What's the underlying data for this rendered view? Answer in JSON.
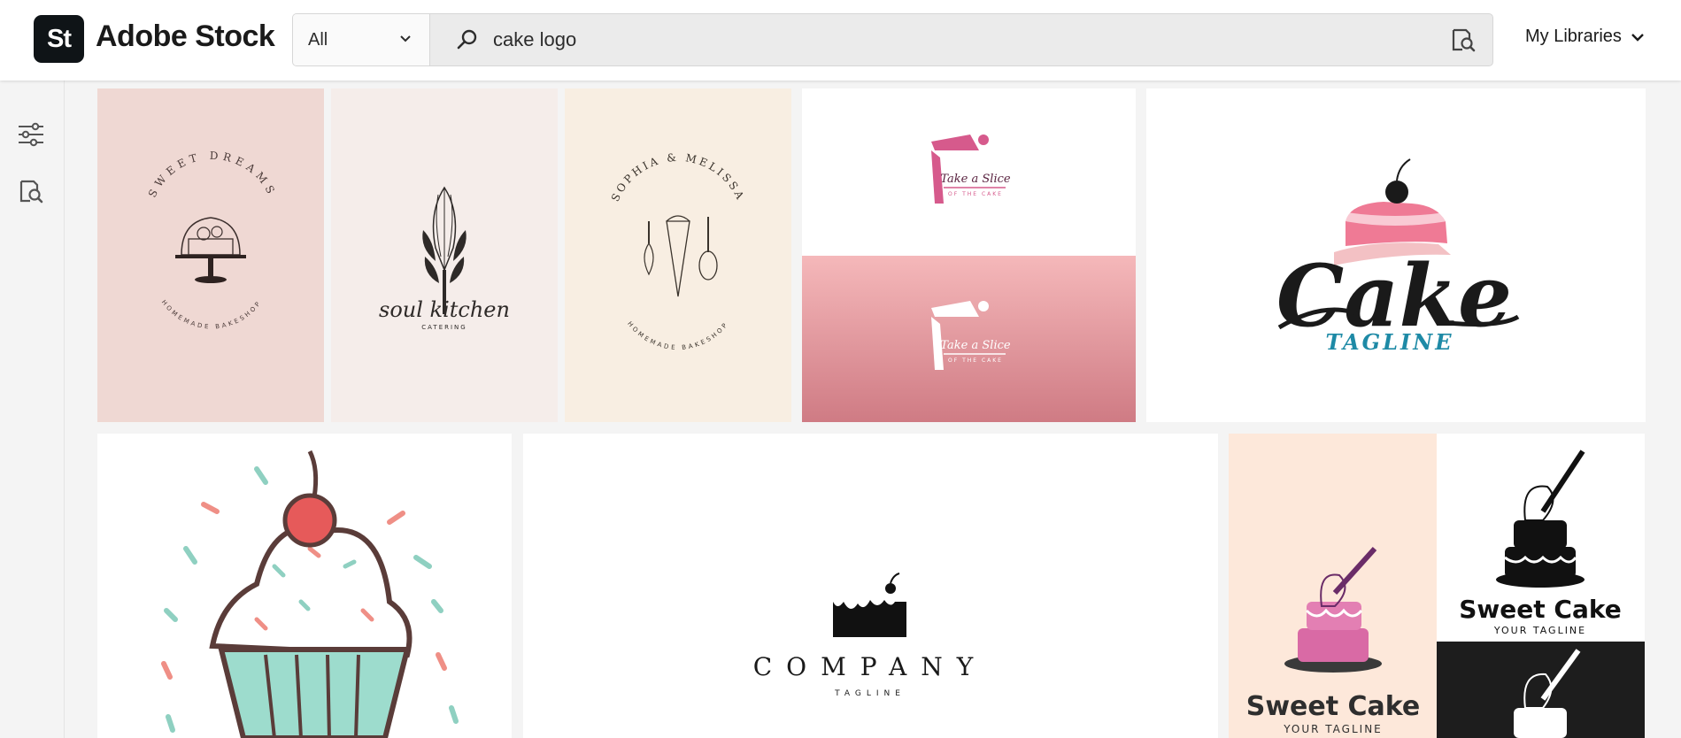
{
  "brand": {
    "badge": "St",
    "name": "Adobe Stock"
  },
  "search": {
    "scope": "All",
    "query": "cake logo",
    "icons": [
      "search-icon",
      "visual-search-icon",
      "chevron-down-icon"
    ]
  },
  "header": {
    "libraries_label": "My Libraries"
  },
  "sidebar": {
    "icons": [
      "filters-icon",
      "visual-search-icon"
    ]
  },
  "results": [
    {
      "id": "sweet-dreams",
      "texts": [
        "SWEET DREAMS",
        "HOMEMADE BAKESHOP"
      ],
      "bg": "#efd8d3"
    },
    {
      "id": "soul-kitchen",
      "texts": [
        "soul kitchen",
        "CATERING"
      ],
      "bg": "#f5edea"
    },
    {
      "id": "sophia-melissa",
      "texts": [
        "SOPHIA & MELISSA",
        "HOMEMADE BAKESHOP"
      ],
      "bg": "#f8eee2"
    },
    {
      "id": "take-a-slice",
      "texts": [
        "Take a Slice",
        "OF THE CAKE"
      ],
      "bg": "#ffffff"
    },
    {
      "id": "cake-tagline",
      "texts": [
        "Cake",
        "TAGLINE"
      ],
      "bg": "#ffffff"
    },
    {
      "id": "cupcake",
      "texts": [],
      "bg": "#ffffff"
    },
    {
      "id": "company",
      "texts": [
        "COMPANY",
        "TAGLINE"
      ],
      "bg": "#ffffff"
    },
    {
      "id": "sweet-cake",
      "texts": [
        "Sweet Cake",
        "YOUR TAGLINE"
      ],
      "bg": "#fde8da"
    }
  ],
  "colors": {
    "accent_pink": "#d65a8c",
    "teal": "#1e8aa6",
    "dark": "#1a1a1a"
  }
}
